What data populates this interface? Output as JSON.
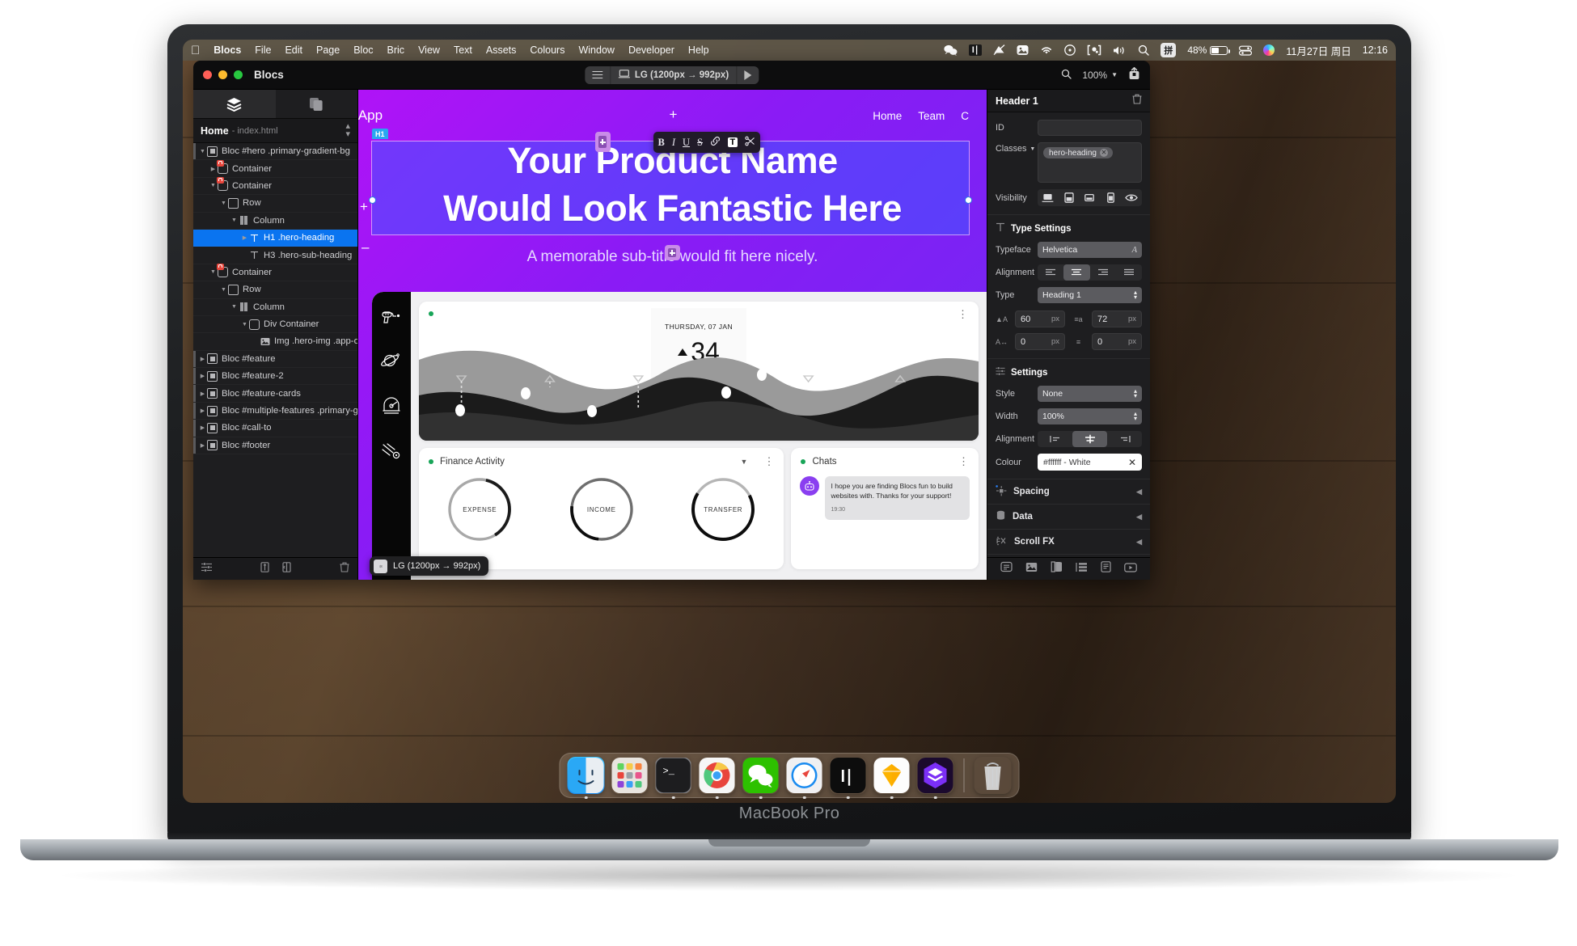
{
  "device": {
    "label": "MacBook Pro"
  },
  "menubar": {
    "apple_icon": "apple-logo",
    "items": [
      "Blocs",
      "File",
      "Edit",
      "Page",
      "Bloc",
      "Bric",
      "View",
      "Text",
      "Assets",
      "Colours",
      "Window",
      "Developer",
      "Help"
    ],
    "status_icons": [
      "wechat-icon",
      "logitech-icon",
      "notification-icon",
      "photos-icon",
      "wifi-icon",
      "timemachine-icon",
      "screen-record-icon",
      "volume-icon",
      "search-icon"
    ],
    "ime": "拼",
    "battery_percent": "48%",
    "control_center": "control-center-icon",
    "siri": "siri-icon",
    "date": "11月27日 周日",
    "time": "12:16"
  },
  "window": {
    "title": "Blocs",
    "viewport_label": "LG (1200px → 992px)",
    "zoom": "100%"
  },
  "left_panel": {
    "tabs": [
      {
        "name": "layers-tab",
        "icon": "layers-icon",
        "active": true
      },
      {
        "name": "pages-tab",
        "icon": "copy-icon",
        "active": false
      }
    ],
    "page_name": "Home",
    "page_file": "- index.html",
    "tree": [
      {
        "label": "Bloc #hero .primary-gradient-bg",
        "depth": 0,
        "icon": "bloc-icon",
        "twisty": "down",
        "locked": false,
        "selected": false
      },
      {
        "label": "Container",
        "depth": 1,
        "icon": "container-icon",
        "twisty": "right",
        "locked": true,
        "selected": false
      },
      {
        "label": "Container",
        "depth": 1,
        "icon": "container-icon",
        "twisty": "down",
        "locked": true,
        "selected": false
      },
      {
        "label": "Row",
        "depth": 2,
        "icon": "row-icon",
        "twisty": "down",
        "locked": false,
        "selected": false
      },
      {
        "label": "Column",
        "depth": 3,
        "icon": "column-icon",
        "twisty": "down",
        "locked": false,
        "selected": false
      },
      {
        "label": "H1 .hero-heading",
        "depth": 4,
        "icon": "text-icon",
        "twisty": "right",
        "locked": false,
        "selected": true
      },
      {
        "label": "H3 .hero-sub-heading",
        "depth": 4,
        "icon": "text-icon",
        "twisty": "none",
        "locked": false,
        "selected": false
      },
      {
        "label": "Container",
        "depth": 1,
        "icon": "container-icon",
        "twisty": "down",
        "locked": true,
        "selected": false
      },
      {
        "label": "Row",
        "depth": 2,
        "icon": "row-icon",
        "twisty": "down",
        "locked": false,
        "selected": false
      },
      {
        "label": "Column",
        "depth": 3,
        "icon": "column-icon",
        "twisty": "down",
        "locked": false,
        "selected": false
      },
      {
        "label": "Div Container",
        "depth": 4,
        "icon": "div-icon",
        "twisty": "down",
        "locked": false,
        "selected": false
      },
      {
        "label": "Img .hero-img .app-offset-",
        "depth": 5,
        "icon": "image-icon",
        "twisty": "none",
        "locked": false,
        "selected": false
      },
      {
        "label": "Bloc #feature",
        "depth": 0,
        "icon": "bloc-icon",
        "twisty": "right",
        "locked": false,
        "selected": false
      },
      {
        "label": "Bloc #feature-2",
        "depth": 0,
        "icon": "bloc-icon",
        "twisty": "right",
        "locked": false,
        "selected": false
      },
      {
        "label": "Bloc #feature-cards",
        "depth": 0,
        "icon": "bloc-icon",
        "twisty": "right",
        "locked": false,
        "selected": false
      },
      {
        "label": "Bloc #multiple-features .primary-gradi…",
        "depth": 0,
        "icon": "bloc-icon",
        "twisty": "right",
        "locked": false,
        "selected": false
      },
      {
        "label": "Bloc #call-to",
        "depth": 0,
        "icon": "bloc-icon",
        "twisty": "right",
        "locked": false,
        "selected": false
      },
      {
        "label": "Bloc #footer",
        "depth": 0,
        "icon": "bloc-icon",
        "twisty": "right",
        "locked": false,
        "selected": false
      }
    ],
    "footer_icons": [
      "settings-icon",
      "split-vertical-icon",
      "split-horizontal-icon",
      "trash-icon"
    ]
  },
  "canvas": {
    "site_brand": "uper App",
    "nav_links": [
      "Home",
      "Team",
      "C"
    ],
    "h1_badge": "H1",
    "hero_heading_line1": "Your Product Name",
    "hero_heading_line2": "Would Look Fantastic Here",
    "hero_sub": "A memorable sub-title would fit here nicely.",
    "format_toolbar": [
      "B",
      "I",
      "U",
      "S",
      "link-icon",
      "T",
      "clear-format-icon"
    ],
    "viewport_tooltip": "LG (1200px → 992px)",
    "mockup": {
      "rail_icons": [
        "raygun-icon",
        "planet-icon",
        "radar-icon",
        "comet-icon"
      ],
      "weather_date": "THURSDAY, 07 JAN",
      "weather_temp": "34",
      "finance_title": "Finance Activity",
      "donuts": [
        "EXPENSE",
        "INCOME",
        "TRANSFER"
      ],
      "chats_title": "Chats",
      "chat_message": "I hope you are finding Blocs fun to build websites with. Thanks for your support!",
      "chat_time": "19:30"
    }
  },
  "right_panel": {
    "header_title": "Header 1",
    "id_label": "ID",
    "id_value": "",
    "classes_label": "Classes",
    "classes": [
      "hero-heading"
    ],
    "visibility_label": "Visibility",
    "visibility_icons": [
      "desktop-icon",
      "tablet-icon",
      "tablet-small-icon",
      "mobile-icon",
      "eye-icon"
    ],
    "type_settings": {
      "title": "Type Settings",
      "typeface_label": "Typeface",
      "typeface_value": "Helvetica",
      "alignment_label": "Alignment",
      "alignment_selected": 1,
      "type_label": "Type",
      "type_value": "Heading 1",
      "font_size": "60",
      "font_size_unit": "px",
      "line_height": "72",
      "line_height_unit": "px",
      "letter_spacing": "0",
      "letter_spacing_unit": "px",
      "paragraph_spacing": "0",
      "paragraph_spacing_unit": "px"
    },
    "settings": {
      "title": "Settings",
      "style_label": "Style",
      "style_value": "None",
      "width_label": "Width",
      "width_value": "100%",
      "alignment_label": "Alignment",
      "alignment_selected": 1,
      "colour_label": "Colour",
      "colour_value": "#ffffff - White"
    },
    "collapsed": [
      {
        "label": "Spacing",
        "icon": "spacing-icon"
      },
      {
        "label": "Data",
        "icon": "database-icon"
      },
      {
        "label": "Scroll FX",
        "icon": "scrollfx-icon"
      }
    ],
    "footer_icons": [
      "text-bric-icon",
      "image-bric-icon",
      "style-bric-icon",
      "list-bric-icon",
      "doc-bric-icon",
      "video-bric-icon"
    ]
  },
  "dock": {
    "items": [
      "Finder",
      "Launchpad",
      "Terminal",
      "Chrome",
      "WeChat",
      "Safari",
      "Logitech",
      "Sketch",
      "Blocs"
    ],
    "trash": "Trash"
  },
  "colors": {
    "accent_blue": "#0a74f0",
    "hero_purple": "#a514f5",
    "hero_blue": "#5a6cff",
    "panel_bg": "#1e1e20",
    "selection_blue": "#0a74f0"
  }
}
